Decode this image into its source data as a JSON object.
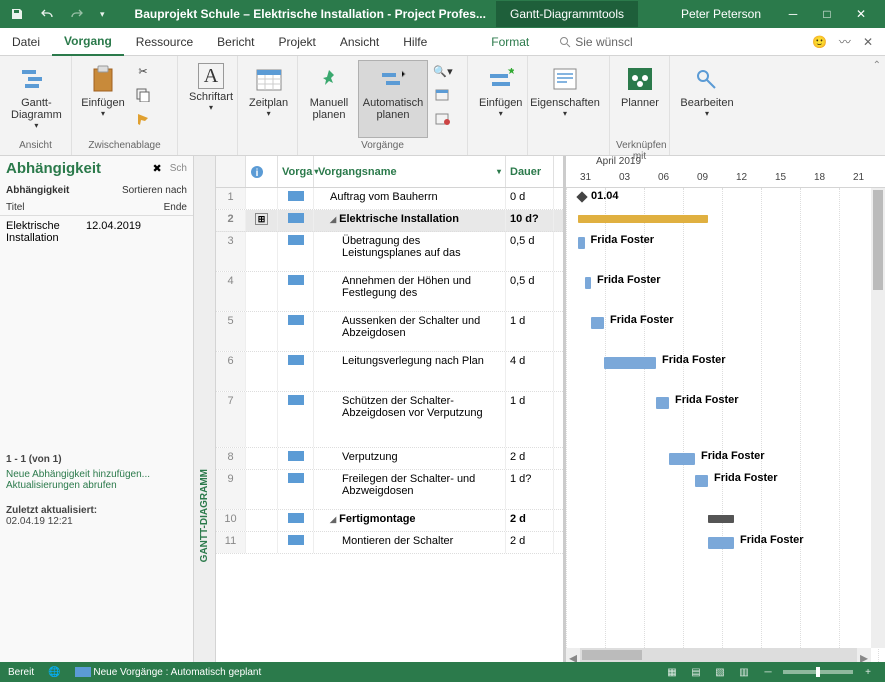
{
  "title": {
    "doc": "Bauprojekt Schule – Elektrische Installation  -  Project Profes...",
    "tool_tab": "Gantt-Diagrammtools",
    "user": "Peter Peterson"
  },
  "tabs": {
    "datei": "Datei",
    "vorgang": "Vorgang",
    "ressource": "Ressource",
    "bericht": "Bericht",
    "projekt": "Projekt",
    "ansicht": "Ansicht",
    "hilfe": "Hilfe",
    "format": "Format",
    "search": "Sie wünscl"
  },
  "ribbon_groups": {
    "ansicht": "Ansicht",
    "zwischenablage": "Zwischenablage",
    "vorgaenge": "Vorgänge",
    "verknuepfen": "Verknüpfen mit"
  },
  "ribbon": {
    "gantt": "Gantt-\nDiagramm",
    "einfuegen": "Einfügen",
    "schriftart": "Schriftart",
    "zeitplan": "Zeitplan",
    "manuell": "Manuell\nplanen",
    "auto": "Automatisch\nplanen",
    "einfuegen2": "Einfügen",
    "eigenschaften": "Eigenschaften",
    "planner": "Planner",
    "bearbeiten": "Bearbeiten"
  },
  "sidepanel": {
    "title": "Abhängigkeit",
    "search_ph": "Sch",
    "sub_a": "Abhängigkeit",
    "sub_b": "Sortieren nach",
    "col_title": "Titel",
    "col_end": "Ende",
    "item_name": "Elektrische\nInstallation",
    "item_date": "12.04.2019",
    "count": "1 - 1 (von 1)",
    "link1": "Neue Abhängigkeit hinzufügen...",
    "link2": "Aktualisierungen abrufen",
    "updated_lbl": "Zuletzt aktualisiert:",
    "updated_val": "02.04.19 12:21"
  },
  "vtab": "GANTT-DIAGRAMM",
  "grid": {
    "col_mode": "Vorga",
    "col_name": "Vorgangsname",
    "col_dur": "Dauer",
    "rows": [
      {
        "n": "1",
        "name": "Auftrag vom Bauherrn",
        "dur": "0 d",
        "indent": 1
      },
      {
        "n": "2",
        "name": "Elektrische Installation",
        "dur": "10 d?",
        "indent": 1,
        "sel": true,
        "outline": true,
        "ind": "⊞"
      },
      {
        "n": "3",
        "name": "Übetragung des Leistungsplanes auf das",
        "dur": "0,5 d",
        "indent": 2
      },
      {
        "n": "4",
        "name": "Annehmen der Höhen und Festlegung des",
        "dur": "0,5 d",
        "indent": 2
      },
      {
        "n": "5",
        "name": "Aussenken der Schalter und Abzeigdosen",
        "dur": "1 d",
        "indent": 2
      },
      {
        "n": "6",
        "name": "Leitungsverlegung nach Plan",
        "dur": "4 d",
        "indent": 2
      },
      {
        "n": "7",
        "name": "Schützen der Schalter-Abzeigdosen vor Verputzung",
        "dur": "1 d",
        "indent": 2
      },
      {
        "n": "8",
        "name": "Verputzung",
        "dur": "2 d",
        "indent": 2
      },
      {
        "n": "9",
        "name": "Freilegen der Schalter- und Abzweigdosen",
        "dur": "1 d?",
        "indent": 2
      },
      {
        "n": "10",
        "name": "Fertigmontage",
        "dur": "2 d",
        "indent": 1,
        "outline": true,
        "bold": true
      },
      {
        "n": "11",
        "name": "Montieren der Schalter",
        "dur": "2 d",
        "indent": 2
      }
    ]
  },
  "gantt": {
    "month": "April 2019",
    "days": [
      "31",
      "03",
      "06",
      "09",
      "12",
      "15",
      "18",
      "21"
    ],
    "milestone_label": "01.04",
    "resource": "Frida Foster"
  },
  "status": {
    "ready": "Bereit",
    "mode": "Neue Vorgänge : Automatisch geplant"
  }
}
